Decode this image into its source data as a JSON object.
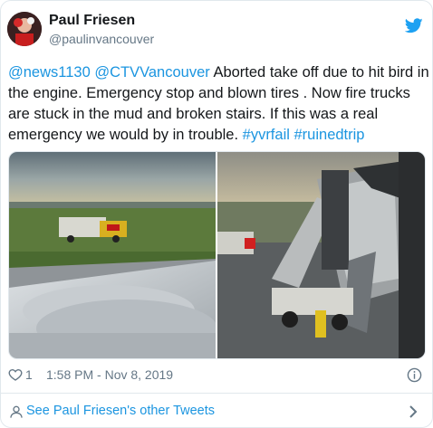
{
  "user": {
    "name": "Paul Friesen",
    "handle": "@paulinvancouver"
  },
  "tweet": {
    "segments": [
      {
        "text": "@news1130",
        "kind": "mention"
      },
      {
        "text": " ",
        "kind": "plain"
      },
      {
        "text": "@CTVVancouver",
        "kind": "mention"
      },
      {
        "text": " Aborted take off due to hit bird in the engine. Emergency stop and blown tires . Now fire trucks are stuck in the mud and broken stairs. If this was a real emergency we would by in trouble. ",
        "kind": "plain"
      },
      {
        "text": "#yvrfail",
        "kind": "tag"
      },
      {
        "text": " ",
        "kind": "plain"
      },
      {
        "text": "#ruinedtrip",
        "kind": "tag"
      }
    ]
  },
  "meta": {
    "likes": "1",
    "timestamp": "1:58 PM - Nov 8, 2019"
  },
  "footer": {
    "more_tweets": "See Paul Friesen's other Tweets"
  },
  "icons": {
    "brand": "twitter-bird-icon",
    "like": "heart-icon",
    "info": "info-icon",
    "profile": "profile-icon",
    "chevron": "chevron-right-icon"
  },
  "colors": {
    "link": "#1b95e0",
    "text": "#14171a",
    "secondary": "#657786",
    "brand": "#1da1f2",
    "border": "#e1e8ed"
  }
}
